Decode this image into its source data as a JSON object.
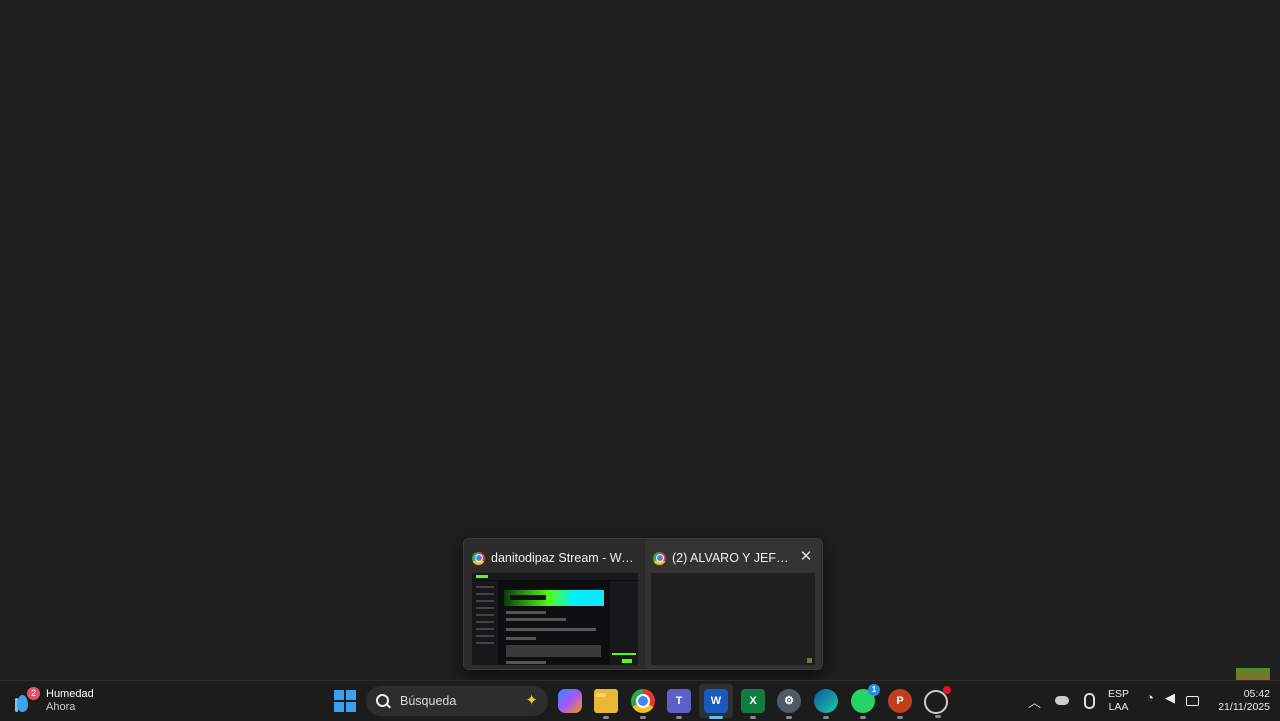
{
  "flyout": {
    "windows": [
      {
        "title": "danitodipaz Stream - Watch..."
      },
      {
        "title": "(2) ALVARO Y JEFFER..."
      }
    ],
    "close_symbol": "✕"
  },
  "taskbar": {
    "weather": {
      "badge": "2",
      "label": "Humedad",
      "time": "Ahora"
    },
    "search": {
      "label": "Búsqueda"
    },
    "apps": {
      "teams": "T",
      "word": "W",
      "excel": "X",
      "whatsapp_badge": "1",
      "powerpoint": "P"
    },
    "tray": {
      "lang": "ESP",
      "layout": "LAA",
      "time": "05:42",
      "date": "21/11/2025"
    }
  },
  "colors": {
    "desktop": "#1f1f1f",
    "taskbar": "#1c1c1c",
    "accent": "#6cb8f0"
  }
}
